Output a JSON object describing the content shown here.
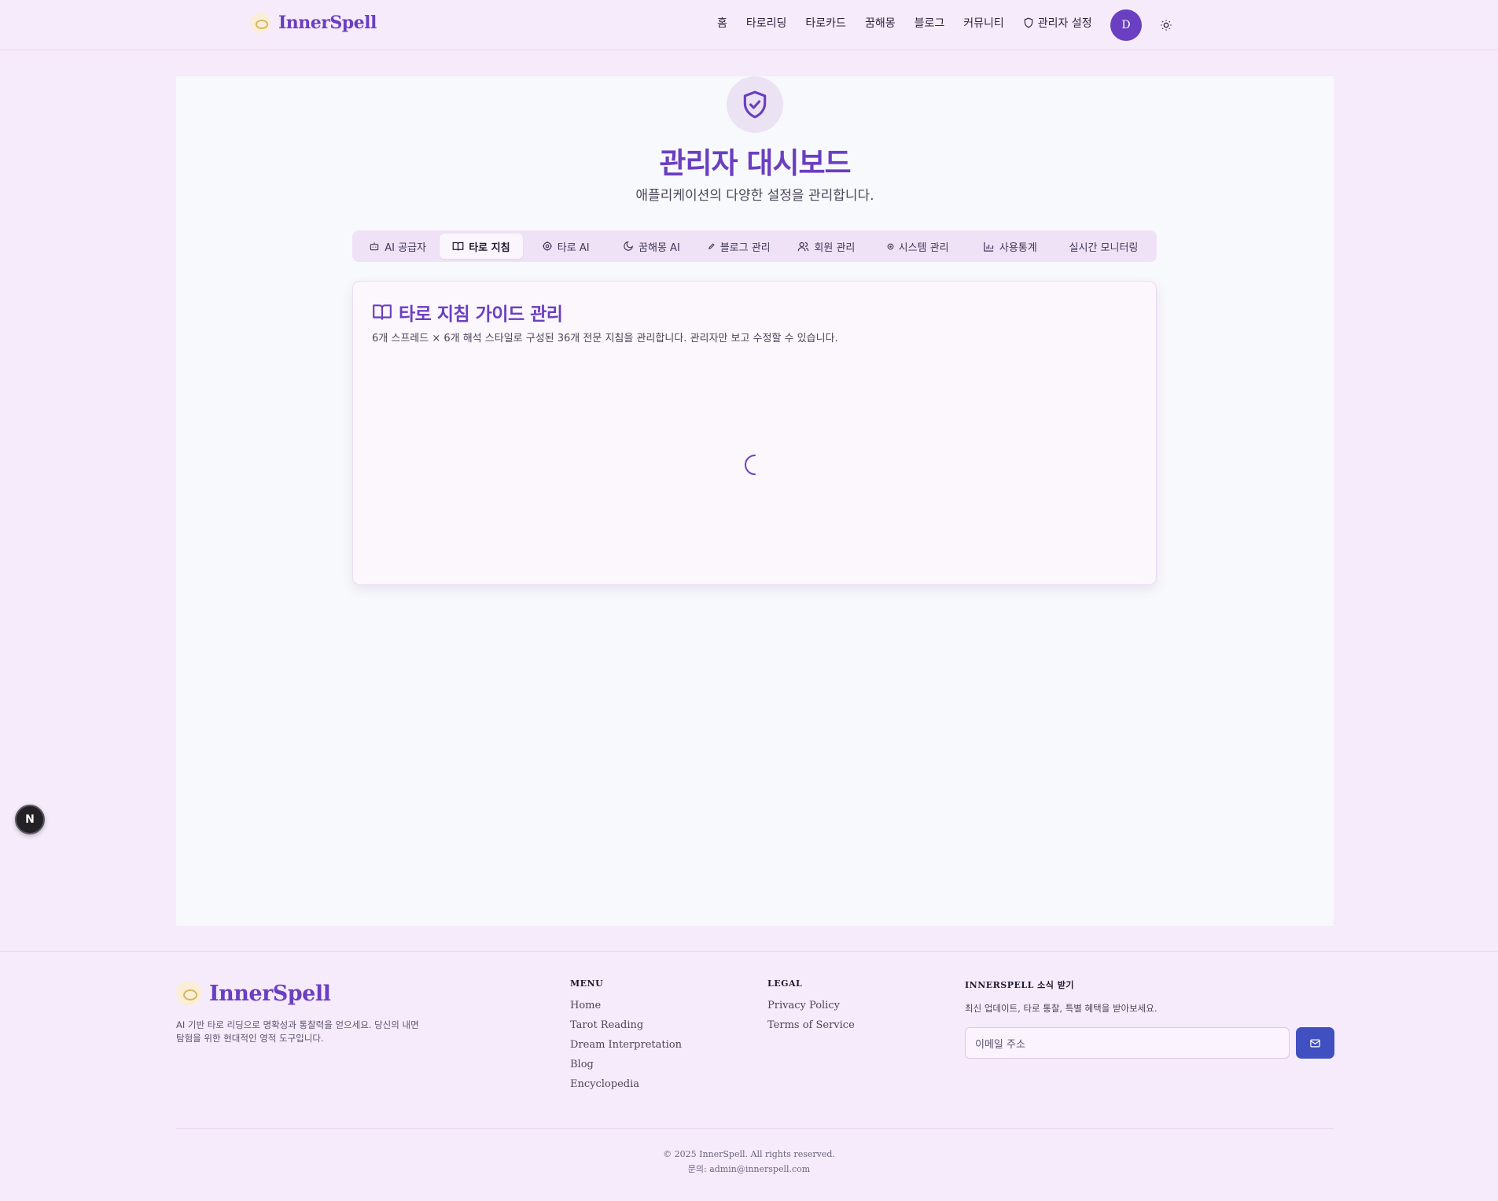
{
  "header": {
    "logo_text": "InnerSpell",
    "nav": [
      "홈",
      "타로리딩",
      "타로카드",
      "꿈해몽",
      "블로그",
      "커뮤니티"
    ],
    "admin_link": "관리자 설정",
    "avatar_initial": "D"
  },
  "page": {
    "title": "관리자 대시보드",
    "subtitle": "애플리케이션의 다양한 설정을 관리합니다."
  },
  "tabs": [
    {
      "label": "AI 공급자",
      "icon": "bot-icon"
    },
    {
      "label": "타로 지침",
      "icon": "book-open-icon",
      "active": true
    },
    {
      "label": "타로 AI",
      "icon": "cog-icon"
    },
    {
      "label": "꿈해몽 AI",
      "icon": "moon-icon"
    },
    {
      "label": "블로그 관리",
      "icon": "pen-icon"
    },
    {
      "label": "회원 관리",
      "icon": "users-icon"
    },
    {
      "label": "시스템 관리",
      "icon": "circle-dot-icon"
    },
    {
      "label": "사용통계",
      "icon": "bar-chart-icon"
    },
    {
      "label": "실시간 모니터링",
      "icon": ""
    }
  ],
  "card": {
    "title": "타로 지침 가이드 관리",
    "description": "6개 스프레드 × 6개 해석 스타일로 구성된 36개 전문 지침을 관리합니다. 관리자만 보고 수정할 수 있습니다."
  },
  "floating_button": {
    "label": "N"
  },
  "footer": {
    "logo_text": "InnerSpell",
    "tagline": "AI 기반 타로 리딩으로 명확성과 통찰력을 얻으세요. 당신의 내면 탐험을 위한 현대적인 영적 도구입니다.",
    "menu_title": "MENU",
    "menu_links": [
      "Home",
      "Tarot Reading",
      "Dream Interpretation",
      "Blog",
      "Encyclopedia"
    ],
    "legal_title": "LEGAL",
    "legal_links": [
      "Privacy Policy",
      "Terms of Service"
    ],
    "newsletter_title": "INNERSPELL 소식 받기",
    "newsletter_desc": "최신 업데이트, 타로 통찰, 특별 혜택을 받아보세요.",
    "email_placeholder": "이메일 주소",
    "copyright": "© 2025 InnerSpell. All rights reserved.",
    "contact": "문의: admin@innerspell.com"
  },
  "colors": {
    "accent": "#6a3fc1",
    "page_bg": "#f6ebfa",
    "panel_bg": "#f8f9fc",
    "send_button": "#4050c0"
  }
}
